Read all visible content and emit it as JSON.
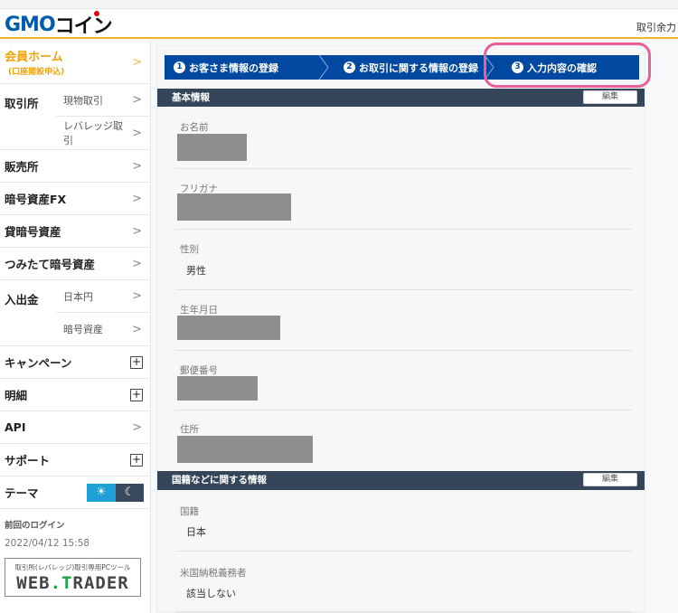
{
  "header": {
    "logo_primary": "GMO",
    "logo_secondary": "コイン",
    "right_text": "取引余力"
  },
  "sidebar": {
    "home": {
      "label": "会員ホーム",
      "sub": "(口座開設申込)"
    },
    "exchange": {
      "label": "取引所",
      "items": [
        "現物取引",
        "レバレッジ取引"
      ]
    },
    "items": [
      {
        "label": "販売所",
        "control": "chevron"
      },
      {
        "label": "暗号資産FX",
        "control": "chevron"
      },
      {
        "label": "貸暗号資産",
        "control": "chevron"
      },
      {
        "label": "つみたて暗号資産",
        "control": "chevron"
      }
    ],
    "deposit": {
      "label": "入出金",
      "items": [
        "日本円",
        "暗号資産"
      ]
    },
    "items2": [
      {
        "label": "キャンペーン",
        "control": "plus"
      },
      {
        "label": "明細",
        "control": "plus"
      },
      {
        "label": "API",
        "control": "chevron"
      },
      {
        "label": "サポート",
        "control": "plus"
      }
    ],
    "theme": {
      "label": "テーマ",
      "light_icon": "☀",
      "dark_icon": "☾",
      "selected": "light"
    },
    "last_login": {
      "title": "前回のログイン",
      "datetime": "2022/04/12 15:58"
    },
    "webtrader": {
      "caption": "取引所(レバレッジ)取引専用PCツール",
      "name_a": "WEB",
      "name_b": ".T",
      "name_c": "RADER"
    }
  },
  "steps": [
    {
      "num": "1",
      "label": "お客さま情報の登録"
    },
    {
      "num": "2",
      "label": "お取引に関する情報の登録"
    },
    {
      "num": "3",
      "label": "入力内容の確認",
      "current": true
    }
  ],
  "sections": [
    {
      "title": "基本情報",
      "edit_label": "編集",
      "fields": [
        {
          "label": "お名前",
          "value": null,
          "redacted": true
        },
        {
          "label": "フリガナ",
          "value": null,
          "redacted": true
        },
        {
          "label": "性別",
          "value": "男性"
        },
        {
          "label": "生年月日",
          "value": null,
          "redacted": true
        },
        {
          "label": "郵便番号",
          "value": null,
          "redacted": true
        },
        {
          "label": "住所",
          "value": null,
          "redacted": true
        }
      ]
    },
    {
      "title": "国籍などに関する情報",
      "edit_label": "編集",
      "fields": [
        {
          "label": "国籍",
          "value": "日本"
        },
        {
          "label": "米国納税義務者",
          "value": "該当しない"
        }
      ]
    }
  ],
  "colors": {
    "brand_blue": "#0048a0",
    "accent_yellow": "#f0a30a",
    "section_header": "#35465a",
    "highlight": "#e8609a",
    "theme_light": "#1ea0d6"
  }
}
